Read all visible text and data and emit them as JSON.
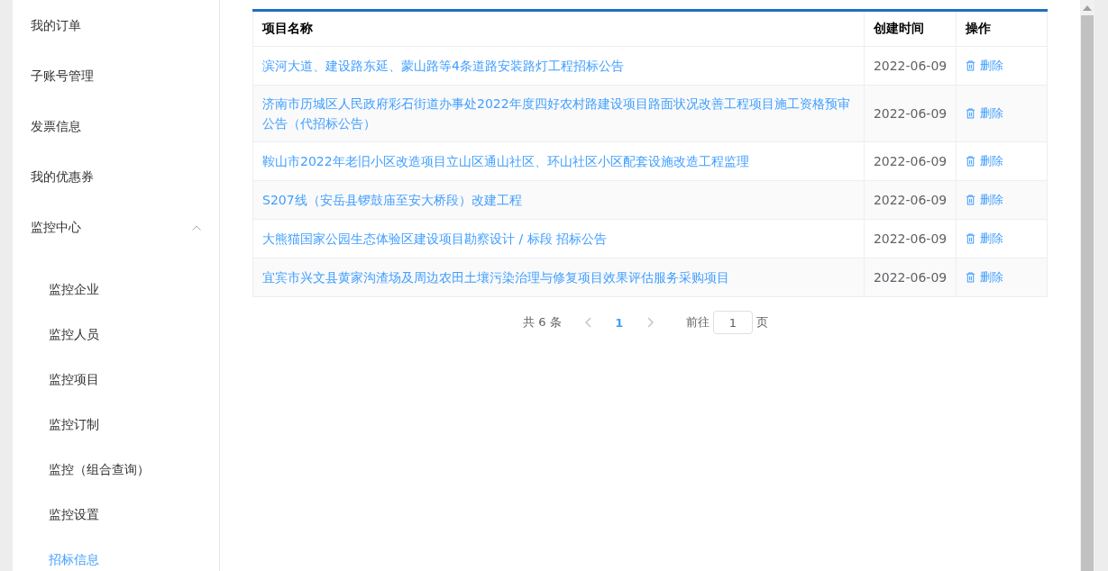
{
  "sidebar": {
    "items": [
      {
        "label": "我的订单"
      },
      {
        "label": "子账号管理"
      },
      {
        "label": "发票信息"
      },
      {
        "label": "我的优惠券"
      },
      {
        "label": "监控中心",
        "expanded": true,
        "children": [
          {
            "label": "监控企业",
            "selected": false
          },
          {
            "label": "监控人员",
            "selected": false
          },
          {
            "label": "监控项目",
            "selected": false
          },
          {
            "label": "监控订制",
            "selected": false
          },
          {
            "label": "监控（组合查询）",
            "selected": false
          },
          {
            "label": "监控设置",
            "selected": false
          },
          {
            "label": "招标信息",
            "selected": true
          }
        ]
      }
    ]
  },
  "table": {
    "columns": [
      "项目名称",
      "创建时间",
      "操作"
    ],
    "rows": [
      {
        "name": "滨河大道、建设路东延、蒙山路等4条道路安装路灯工程招标公告",
        "date": "2022-06-09",
        "action": "删除"
      },
      {
        "name": "济南市历城区人民政府彩石街道办事处2022年度四好农村路建设项目路面状况改善工程项目施工资格预审公告（代招标公告）",
        "date": "2022-06-09",
        "action": "删除"
      },
      {
        "name": "鞍山市2022年老旧小区改造项目立山区通山社区、环山社区小区配套设施改造工程监理",
        "date": "2022-06-09",
        "action": "删除"
      },
      {
        "name": "S207线（安岳县锣鼓庙至安大桥段）改建工程",
        "date": "2022-06-09",
        "action": "删除"
      },
      {
        "name": "大熊猫国家公园生态体验区建设项目勘察设计 / 标段 招标公告",
        "date": "2022-06-09",
        "action": "删除"
      },
      {
        "name": "宜宾市兴文县黄家沟渣场及周边农田土壤污染治理与修复项目效果评估服务采购项目",
        "date": "2022-06-09",
        "action": "删除"
      }
    ]
  },
  "pagination": {
    "total": "共 6 条",
    "pages": [
      {
        "label": "1",
        "selected": true
      }
    ],
    "goto_label": "前往",
    "goto_value": "1",
    "goto_suffix": "页"
  }
}
